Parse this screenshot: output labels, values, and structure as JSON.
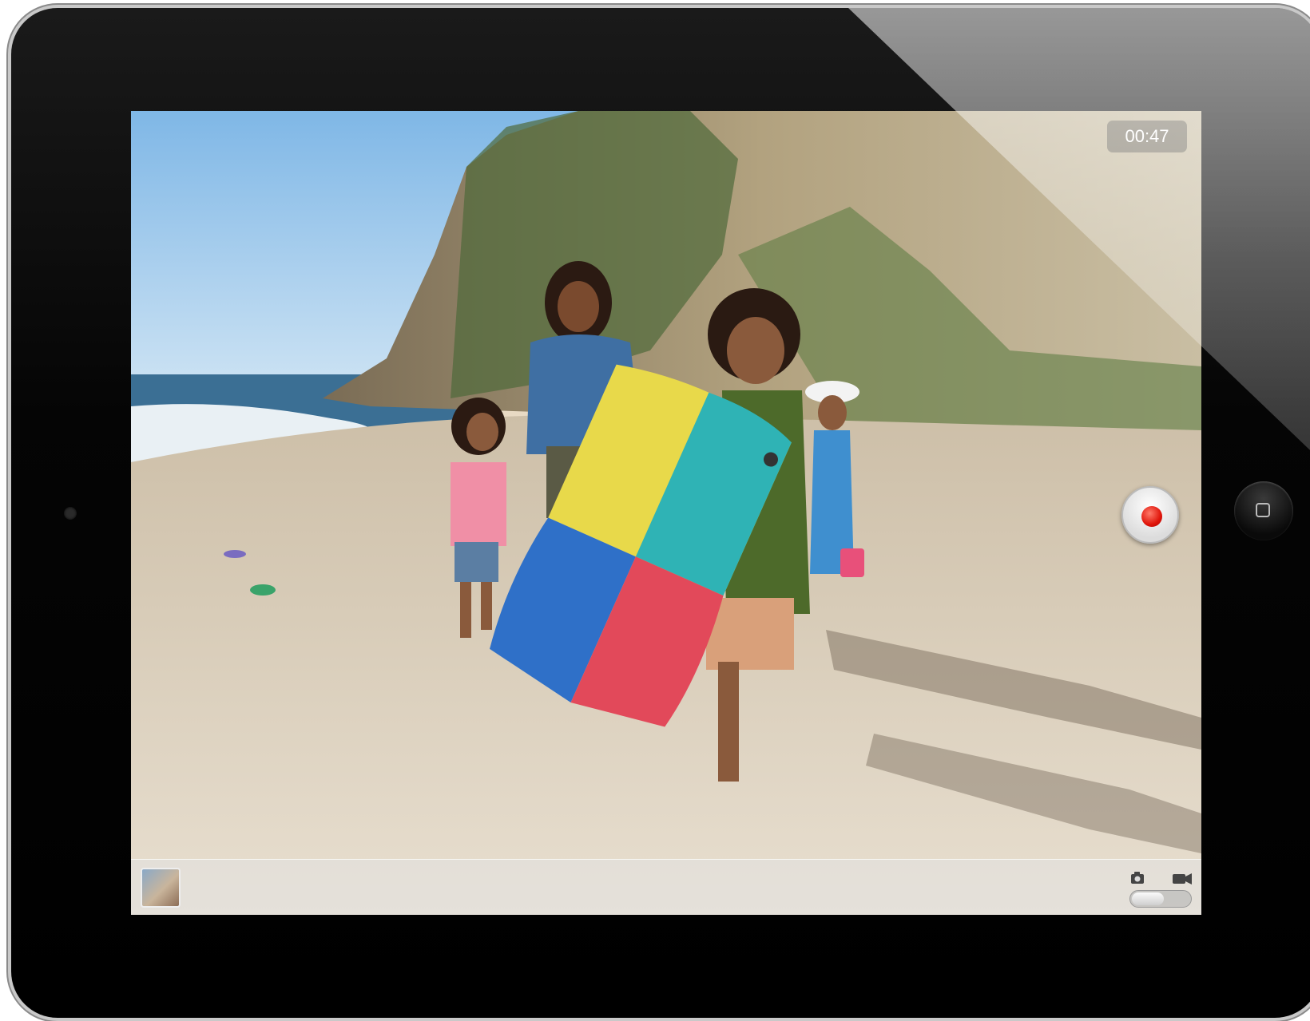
{
  "camera": {
    "record_timer": "00:47",
    "mode": "video"
  },
  "icons": {
    "record": "record-icon",
    "camera_mode": "camera-icon",
    "video_mode": "video-camera-icon",
    "last_photo": "photo-thumbnail",
    "home": "home-button-icon"
  },
  "colors": {
    "record_red": "#e0150a",
    "bezel": "#000000"
  }
}
